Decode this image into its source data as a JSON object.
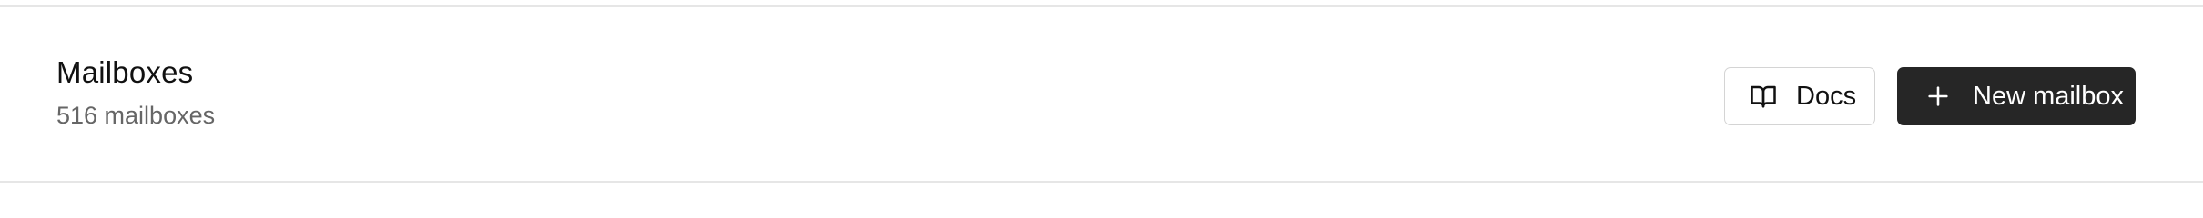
{
  "header": {
    "title": "Mailboxes",
    "subtitle": "516 mailboxes"
  },
  "actions": {
    "docs_label": "Docs",
    "docs_icon": "book-open-icon",
    "new_label": "New mailbox",
    "new_icon": "plus-icon"
  },
  "colors": {
    "primary_button": "#262626",
    "border": "#e6e6e6",
    "muted_text": "#666666"
  }
}
